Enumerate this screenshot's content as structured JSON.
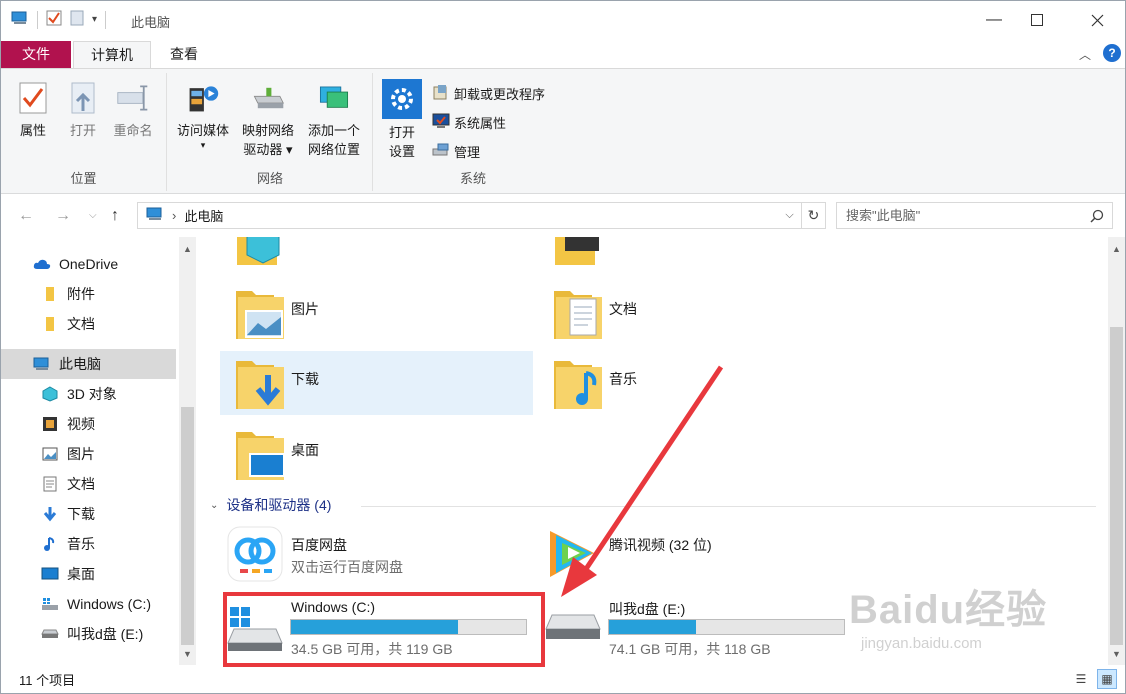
{
  "window": {
    "title": "此电脑",
    "controls": [
      "minimize",
      "maximize",
      "close"
    ]
  },
  "ribbon_tabs": [
    {
      "label": "文件"
    },
    {
      "label": "计算机"
    },
    {
      "label": "查看"
    }
  ],
  "ribbon": {
    "location_group": {
      "label": "位置",
      "buttons": [
        {
          "label": "属性",
          "icon": "properties-icon",
          "enabled": true
        },
        {
          "label": "打开",
          "icon": "open-icon",
          "enabled": false
        },
        {
          "label": "重命名",
          "icon": "rename-icon",
          "enabled": false
        }
      ]
    },
    "network_group": {
      "label": "网络",
      "buttons": [
        {
          "label_line1": "访问媒体",
          "label_line2": "▾",
          "icon": "media-icon"
        },
        {
          "label_line1": "映射网络",
          "label_line2": "驱动器 ▾",
          "icon": "map-network-drive-icon"
        },
        {
          "label_line1": "添加一个",
          "label_line2": "网络位置",
          "icon": "add-network-location-icon"
        }
      ]
    },
    "system_group": {
      "label": "系统",
      "open_settings_line1": "打开",
      "open_settings_line2": "设置",
      "small_buttons": [
        {
          "label": "卸载或更改程序",
          "icon": "uninstall-icon"
        },
        {
          "label": "系统属性",
          "icon": "system-properties-icon"
        },
        {
          "label": "管理",
          "icon": "manage-icon"
        }
      ]
    }
  },
  "address": {
    "path": "此电脑",
    "search_placeholder": "搜索\"此电脑\""
  },
  "nav_pane": {
    "items": [
      {
        "label": "OneDrive",
        "icon": "onedrive-icon"
      },
      {
        "label": "附件",
        "icon": "folder-icon"
      },
      {
        "label": "文档",
        "icon": "folder-icon"
      },
      {
        "label": "此电脑",
        "icon": "this-pc-icon",
        "selected": true
      },
      {
        "label": "3D 对象",
        "icon": "3d-objects-icon"
      },
      {
        "label": "视频",
        "icon": "videos-icon"
      },
      {
        "label": "图片",
        "icon": "pictures-icon"
      },
      {
        "label": "文档",
        "icon": "documents-icon"
      },
      {
        "label": "下载",
        "icon": "downloads-icon"
      },
      {
        "label": "音乐",
        "icon": "music-icon"
      },
      {
        "label": "桌面",
        "icon": "desktop-icon"
      },
      {
        "label": "Windows (C:)",
        "icon": "windows-drive-icon"
      },
      {
        "label": "叫我d盘 (E:)",
        "icon": "drive-icon"
      }
    ]
  },
  "folders": [
    {
      "label": "图片",
      "icon": "pictures-folder-icon"
    },
    {
      "label": "文档",
      "icon": "documents-folder-icon"
    },
    {
      "label": "下载",
      "icon": "downloads-folder-icon",
      "selected": true
    },
    {
      "label": "音乐",
      "icon": "music-folder-icon"
    },
    {
      "label": "桌面",
      "icon": "desktop-folder-icon"
    }
  ],
  "devices_section": {
    "title": "设备和驱动器 (4)"
  },
  "devices": [
    {
      "name": "百度网盘",
      "sub": "双击运行百度网盘",
      "icon": "baidu-netdisk-icon"
    },
    {
      "name": "腾讯视频 (32 位)",
      "icon": "tencent-video-icon"
    },
    {
      "name": "Windows (C:)",
      "sub": "34.5 GB 可用，共 119 GB",
      "used_fraction": 0.71,
      "icon": "windows-drive-icon"
    },
    {
      "name": "叫我d盘 (E:)",
      "sub": "74.1 GB 可用，共 118 GB",
      "used_fraction": 0.37,
      "icon": "drive-icon"
    }
  ],
  "status": {
    "item_count": "11 个项目"
  },
  "watermark": {
    "text": "Baidu经验",
    "url": "jingyan.baidu.com"
  },
  "colors": {
    "file_tab": "#b1124e",
    "selection": "#e5f1fb",
    "drive_bar": "#26a0da",
    "annotation": "#e8383d"
  }
}
